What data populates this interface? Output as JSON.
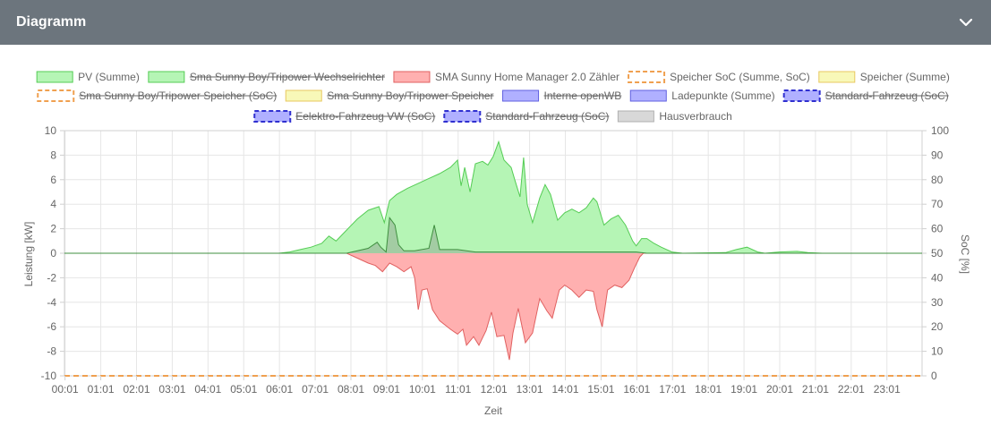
{
  "header": {
    "title": "Diagramm"
  },
  "chart_data": {
    "type": "area",
    "xlabel": "Zeit",
    "ylabel": "Leistung [kW]",
    "y2label": "SoC [%]",
    "ylim": [
      -10,
      10
    ],
    "y2lim": [
      0,
      100
    ],
    "yticks": [
      10,
      8,
      6,
      4,
      2,
      0,
      -2,
      -4,
      -6,
      -8,
      -10
    ],
    "y2ticks": [
      100,
      90,
      80,
      70,
      60,
      50,
      40,
      30,
      20,
      10,
      0
    ],
    "xlim": [
      0,
      24
    ],
    "xticks": [
      "00:01",
      "01:01",
      "02:01",
      "03:01",
      "04:01",
      "05:01",
      "06:01",
      "07:01",
      "08:01",
      "09:01",
      "10:01",
      "11:01",
      "12:01",
      "13:01",
      "14:01",
      "15:01",
      "16:01",
      "17:01",
      "18:01",
      "19:01",
      "20:01",
      "21:01",
      "22:01",
      "23:01"
    ],
    "grid": true,
    "legend_position": "top",
    "legend": [
      {
        "label": "PV (Summe)",
        "fill": "#b5f5b5",
        "stroke": "#55cc55",
        "hidden": false,
        "dashed": false
      },
      {
        "label": "Sma Sunny Boy/Tripower Wechselrichter",
        "fill": "#b5f5b5",
        "stroke": "#55cc55",
        "hidden": true,
        "dashed": false
      },
      {
        "label": "SMA Sunny Home Manager 2.0 Zähler",
        "fill": "#ffb0b0",
        "stroke": "#e06060",
        "hidden": false,
        "dashed": false
      },
      {
        "label": "Speicher SoC (Summe, SoC)",
        "fill": "#ffffff",
        "stroke": "#f0a050",
        "hidden": false,
        "dashed": true
      },
      {
        "label": "Speicher (Summe)",
        "fill": "#f8f8b8",
        "stroke": "#e8c860",
        "hidden": false,
        "dashed": false
      },
      {
        "label": "Sma Sunny Boy/Tripower Speicher (SoC)",
        "fill": "#ffffff",
        "stroke": "#f0a050",
        "hidden": true,
        "dashed": true
      },
      {
        "label": "Sma Sunny Boy/Tripower Speicher",
        "fill": "#f8f8b8",
        "stroke": "#e8c860",
        "hidden": true,
        "dashed": false
      },
      {
        "label": "Interne openWB",
        "fill": "#b0b0ff",
        "stroke": "#6060e0",
        "hidden": true,
        "dashed": false
      },
      {
        "label": "Ladepunkte (Summe)",
        "fill": "#b0b0ff",
        "stroke": "#6060e0",
        "hidden": false,
        "dashed": false
      },
      {
        "label": "Standard-Fahrzeug (SoC)",
        "fill": "#b0b0ff",
        "stroke": "#3030d0",
        "hidden": true,
        "dashed": true
      },
      {
        "label": "Eelektro-Fahrzeug VW (SoC)",
        "fill": "#b0b0ff",
        "stroke": "#3030d0",
        "hidden": true,
        "dashed": true
      },
      {
        "label": "Standard-Fahrzeug (SoC)",
        "fill": "#b0b0ff",
        "stroke": "#3030d0",
        "hidden": true,
        "dashed": true
      },
      {
        "label": "Hausverbrauch",
        "fill": "#d8d8d8",
        "stroke": "#b0b0b0",
        "hidden": false,
        "dashed": false
      }
    ],
    "series": [
      {
        "name": "PV (Summe)",
        "color": "#55cc55",
        "fill": "#b5f5b5",
        "points": [
          [
            0,
            0
          ],
          [
            6.0,
            0
          ],
          [
            6.3,
            0.1
          ],
          [
            6.6,
            0.3
          ],
          [
            6.9,
            0.5
          ],
          [
            7.2,
            0.8
          ],
          [
            7.4,
            1.4
          ],
          [
            7.6,
            1.0
          ],
          [
            7.9,
            1.9
          ],
          [
            8.2,
            2.8
          ],
          [
            8.5,
            3.5
          ],
          [
            8.8,
            3.8
          ],
          [
            8.95,
            2.5
          ],
          [
            9.1,
            4.3
          ],
          [
            9.3,
            4.8
          ],
          [
            9.6,
            5.3
          ],
          [
            9.9,
            5.7
          ],
          [
            10.2,
            6.1
          ],
          [
            10.5,
            6.5
          ],
          [
            10.8,
            7.0
          ],
          [
            11.0,
            7.6
          ],
          [
            11.1,
            5.5
          ],
          [
            11.2,
            7.0
          ],
          [
            11.35,
            5.0
          ],
          [
            11.5,
            7.3
          ],
          [
            11.7,
            7.5
          ],
          [
            11.85,
            7.2
          ],
          [
            12.0,
            7.9
          ],
          [
            12.15,
            9.1
          ],
          [
            12.3,
            7.6
          ],
          [
            12.5,
            7.0
          ],
          [
            12.6,
            6.0
          ],
          [
            12.75,
            4.6
          ],
          [
            12.85,
            7.8
          ],
          [
            12.95,
            4.0
          ],
          [
            13.1,
            2.5
          ],
          [
            13.3,
            4.5
          ],
          [
            13.45,
            5.6
          ],
          [
            13.6,
            4.8
          ],
          [
            13.8,
            2.7
          ],
          [
            14.0,
            3.3
          ],
          [
            14.2,
            3.6
          ],
          [
            14.4,
            3.3
          ],
          [
            14.6,
            3.7
          ],
          [
            14.8,
            4.5
          ],
          [
            14.9,
            4.2
          ],
          [
            15.1,
            2.3
          ],
          [
            15.3,
            2.8
          ],
          [
            15.5,
            3.1
          ],
          [
            15.7,
            2.3
          ],
          [
            15.9,
            1.0
          ],
          [
            16.0,
            0.6
          ],
          [
            16.15,
            1.2
          ],
          [
            16.3,
            1.2
          ],
          [
            16.5,
            0.8
          ],
          [
            16.7,
            0.5
          ],
          [
            17.0,
            0.1
          ],
          [
            17.3,
            0.0
          ],
          [
            18.5,
            0.05
          ],
          [
            18.8,
            0.3
          ],
          [
            19.1,
            0.5
          ],
          [
            19.4,
            0.1
          ],
          [
            19.6,
            0.0
          ],
          [
            20.0,
            0.1
          ],
          [
            20.5,
            0.15
          ],
          [
            20.8,
            0.05
          ],
          [
            21.2,
            0.0
          ],
          [
            24,
            0
          ]
        ]
      },
      {
        "name": "SMA Sunny Home Manager 2.0 Zähler",
        "color": "#e06060",
        "fill": "#ffb0b0",
        "points": [
          [
            0,
            0
          ],
          [
            7.9,
            0
          ],
          [
            8.2,
            -0.4
          ],
          [
            8.5,
            -0.8
          ],
          [
            8.7,
            -1.0
          ],
          [
            8.9,
            -1.5
          ],
          [
            9.1,
            -0.8
          ],
          [
            9.3,
            -1.1
          ],
          [
            9.5,
            -1.5
          ],
          [
            9.7,
            -1.1
          ],
          [
            9.8,
            -2.0
          ],
          [
            9.9,
            -4.6
          ],
          [
            10.0,
            -3.0
          ],
          [
            10.15,
            -2.9
          ],
          [
            10.3,
            -4.6
          ],
          [
            10.5,
            -5.5
          ],
          [
            10.8,
            -6.2
          ],
          [
            11.0,
            -6.6
          ],
          [
            11.15,
            -6.2
          ],
          [
            11.25,
            -7.5
          ],
          [
            11.45,
            -6.8
          ],
          [
            11.6,
            -7.5
          ],
          [
            11.8,
            -6.3
          ],
          [
            11.95,
            -4.8
          ],
          [
            12.1,
            -6.8
          ],
          [
            12.3,
            -6.7
          ],
          [
            12.45,
            -8.7
          ],
          [
            12.55,
            -6.5
          ],
          [
            12.7,
            -4.5
          ],
          [
            12.9,
            -7.3
          ],
          [
            13.1,
            -6.5
          ],
          [
            13.3,
            -3.7
          ],
          [
            13.5,
            -4.7
          ],
          [
            13.65,
            -5.3
          ],
          [
            13.85,
            -3.0
          ],
          [
            14.0,
            -2.6
          ],
          [
            14.2,
            -3.0
          ],
          [
            14.4,
            -3.6
          ],
          [
            14.6,
            -3.0
          ],
          [
            14.8,
            -3.1
          ],
          [
            14.9,
            -4.6
          ],
          [
            15.05,
            -6.0
          ],
          [
            15.2,
            -3.0
          ],
          [
            15.4,
            -2.6
          ],
          [
            15.6,
            -2.8
          ],
          [
            15.8,
            -2.2
          ],
          [
            15.95,
            -1.2
          ],
          [
            16.1,
            -0.3
          ],
          [
            16.2,
            0
          ],
          [
            24,
            0
          ]
        ]
      },
      {
        "name": "Hausverbrauch",
        "color": "#3f8f3f",
        "fill": "#808080",
        "points": [
          [
            0,
            0
          ],
          [
            7.9,
            0
          ],
          [
            8.2,
            0.2
          ],
          [
            8.5,
            0.4
          ],
          [
            8.75,
            0.9
          ],
          [
            8.85,
            0.5
          ],
          [
            9.0,
            0.1
          ],
          [
            9.1,
            2.9
          ],
          [
            9.25,
            2.3
          ],
          [
            9.35,
            0.7
          ],
          [
            9.5,
            0.2
          ],
          [
            9.8,
            0.2
          ],
          [
            10.2,
            0.4
          ],
          [
            10.35,
            2.3
          ],
          [
            10.5,
            0.3
          ],
          [
            11.0,
            0.3
          ],
          [
            11.5,
            0.1
          ],
          [
            16.0,
            0.1
          ],
          [
            16.3,
            0.0
          ],
          [
            24,
            0
          ]
        ]
      },
      {
        "name": "Speicher SoC (Summe, SoC)",
        "color": "#f0a050",
        "dashed": true,
        "axis": "y2",
        "points": [
          [
            0,
            0
          ],
          [
            24,
            0
          ]
        ]
      }
    ]
  }
}
